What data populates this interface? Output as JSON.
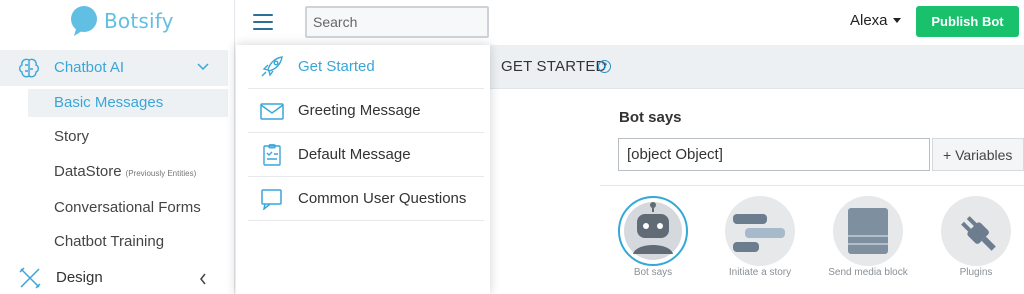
{
  "brand": {
    "name": "Botsify",
    "icon": "speech-bubble-logo"
  },
  "sidebar": {
    "group": {
      "label": "Chatbot AI",
      "icon": "brain-icon",
      "expanded": true
    },
    "items": [
      {
        "label": "Basic Messages",
        "active": true
      },
      {
        "label": "Story"
      },
      {
        "label": "DataStore",
        "note": "(Previously Entities)"
      },
      {
        "label": "Conversational Forms"
      },
      {
        "label": "Chatbot Training"
      }
    ],
    "design": {
      "label": "Design",
      "icon": "design-tools-icon"
    }
  },
  "topbar": {
    "search_placeholder": "Search",
    "search_value": "",
    "user_name": "Alexa",
    "publish_label": "Publish Bot"
  },
  "menu": {
    "items": [
      {
        "label": "Get Started",
        "icon": "rocket-icon",
        "active": true
      },
      {
        "label": "Greeting Message",
        "icon": "envelope-icon"
      },
      {
        "label": "Default Message",
        "icon": "clipboard-icon"
      },
      {
        "label": "Common User Questions",
        "icon": "chat-bubble-icon"
      }
    ]
  },
  "content": {
    "title": "GET STARTED",
    "help_icon": "question-circle-icon",
    "bot_says_label": "Bot says",
    "bot_says_value": "[object Object]",
    "variables_label": "+ Variables",
    "blocks": [
      {
        "caption": "Bot says",
        "icon": "robot-icon",
        "selected": true
      },
      {
        "caption": "Initiate a story",
        "icon": "story-bars-icon"
      },
      {
        "caption": "Send media block",
        "icon": "media-block-icon"
      },
      {
        "caption": "Plugins",
        "icon": "plug-icon"
      }
    ]
  },
  "colors": {
    "accent": "#3aa6d8",
    "publish": "#19c16d",
    "brand": "#62bfe4"
  }
}
